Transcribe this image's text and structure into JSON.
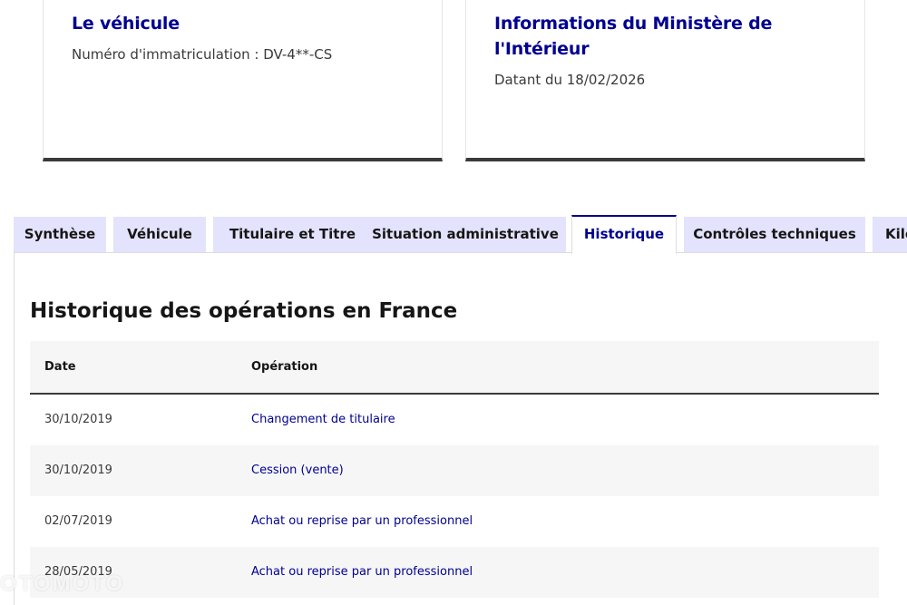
{
  "cards": {
    "vehicle": {
      "title": "Le véhicule",
      "text": "Numéro d'immatriculation : DV-4**-CS"
    },
    "ministry": {
      "title": "Informations du Ministère de l'Intérieur",
      "text": "Datant du 18/02/2026"
    }
  },
  "tabs": [
    {
      "label": "Synthèse",
      "active": false
    },
    {
      "label": "Véhicule",
      "active": false
    },
    {
      "label": "Titulaire et Titre",
      "active": false
    },
    {
      "label": "Situation administrative",
      "active": false
    },
    {
      "label": "Historique",
      "active": true
    },
    {
      "label": "Contrôles techniques",
      "active": false
    },
    {
      "label": "Kilométrage",
      "active": false
    }
  ],
  "history": {
    "title": "Historique des opérations en France",
    "columns": {
      "date": "Date",
      "operation": "Opération"
    },
    "rows": [
      {
        "date": "30/10/2019",
        "operation": "Changement de titulaire"
      },
      {
        "date": "30/10/2019",
        "operation": "Cession (vente)"
      },
      {
        "date": "02/07/2019",
        "operation": "Achat ou reprise par un professionnel"
      },
      {
        "date": "28/05/2019",
        "operation": "Achat ou reprise par un professionnel"
      }
    ]
  },
  "colors": {
    "brand_blue": "#000091",
    "tab_bg": "#e3e3fd",
    "row_alt": "#f6f6f6"
  },
  "watermark": "OTOMOTO"
}
